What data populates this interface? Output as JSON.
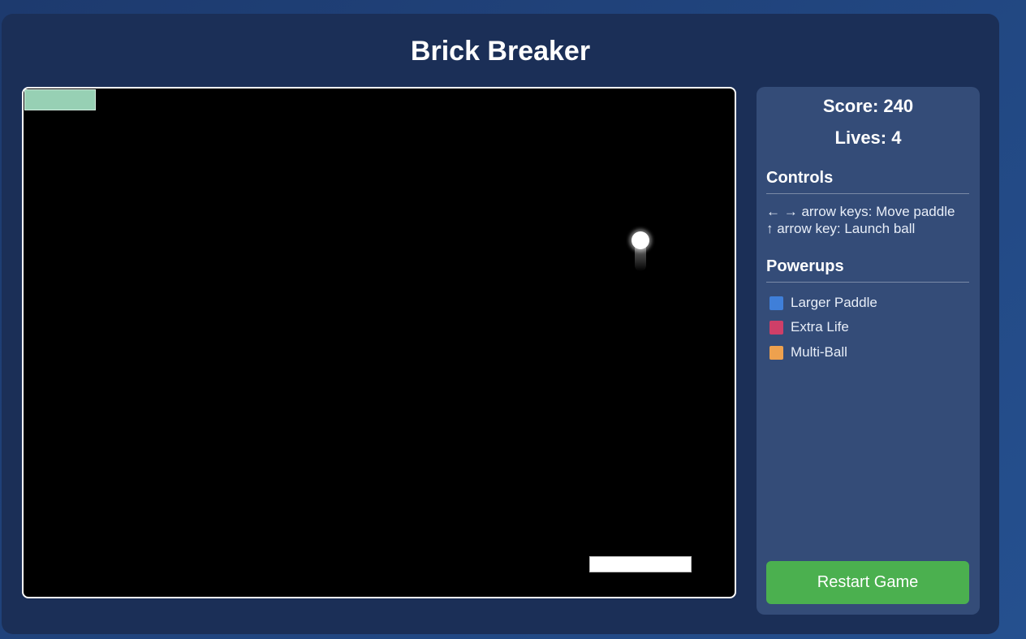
{
  "app": {
    "title": "Brick Breaker"
  },
  "stats": {
    "score_text": "Score: 240",
    "lives_text": "Lives: 4"
  },
  "controls": {
    "heading": "Controls",
    "lines": [
      "← → arrow keys: Move paddle",
      "↑ arrow key: Launch ball"
    ]
  },
  "powerups": {
    "heading": "Powerups",
    "items": [
      {
        "label": "Larger Paddle",
        "color": "#3f7fd9"
      },
      {
        "label": "Extra Life",
        "color": "#cf3f68"
      },
      {
        "label": "Multi-Ball",
        "color": "#eea14e"
      }
    ]
  },
  "game": {
    "brick_color": "#97d0b4",
    "ball_color": "#ffffff",
    "paddle_color": "#ffffff",
    "board_background": "#000000"
  },
  "actions": {
    "restart_label": "Restart Game",
    "restart_color": "#4bb04f"
  }
}
